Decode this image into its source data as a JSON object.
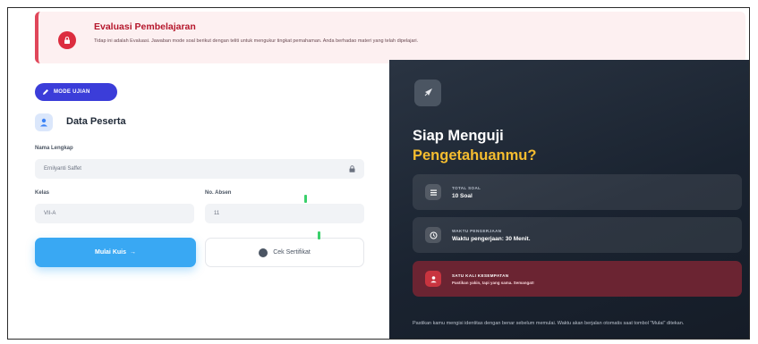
{
  "alert": {
    "title": "Evaluasi Pembelajaran",
    "text": "Tidap ini adalah Evaluasi. Jawaban mode soal berikut dengan teliti untuk mengukur tingkat pemahaman. Anda berhadao materi yang telah dipelajari.",
    "color": "#dc2d3f"
  },
  "left": {
    "badge": "MODE UJIAN",
    "section_title": "Data Peserta",
    "name_label": "Nama Lengkap",
    "name_value": "Ernilyanti Saffet",
    "class_label": "Kelas",
    "class_value": "VII-A",
    "absen_label": "No. Absen",
    "absen_value": "11",
    "start_button": "Mulai Kuis",
    "start_arrow": "→",
    "cert_button": "Cek Sertifikat"
  },
  "right": {
    "hero_line1": "Siap Menguji",
    "hero_line2": "Pengetahuanmu?",
    "cards": [
      {
        "label": "TOTAL SOAL",
        "value": "10 Soal"
      },
      {
        "label": "WAKTU PENGERJAAN",
        "value": "Waktu pengerjaan: 30 Menit."
      },
      {
        "label": "SATU KALI KESEMPATAN",
        "value": "Pastikan yakin, tapi yang sama. Semangat!"
      }
    ],
    "footnote": "Pastikan kamu mengisi identitas dengan benar sebelum memulai. Waktu akan berjalan otomatis saat tombol \"Mulai\" ditekan.",
    "accent": "#f6bd2f"
  },
  "colors": {
    "primary_button": "#39a8f3",
    "badge": "#3b3dd9",
    "dark_panel": "#1a2330"
  },
  "icons": {
    "alert": "lock-icon",
    "badge": "pencil-icon",
    "section": "user-icon",
    "field": "lock-icon",
    "rocket": "rocket-icon",
    "card1": "list-icon",
    "card2": "clock-icon",
    "card3": "user-alert-icon"
  }
}
